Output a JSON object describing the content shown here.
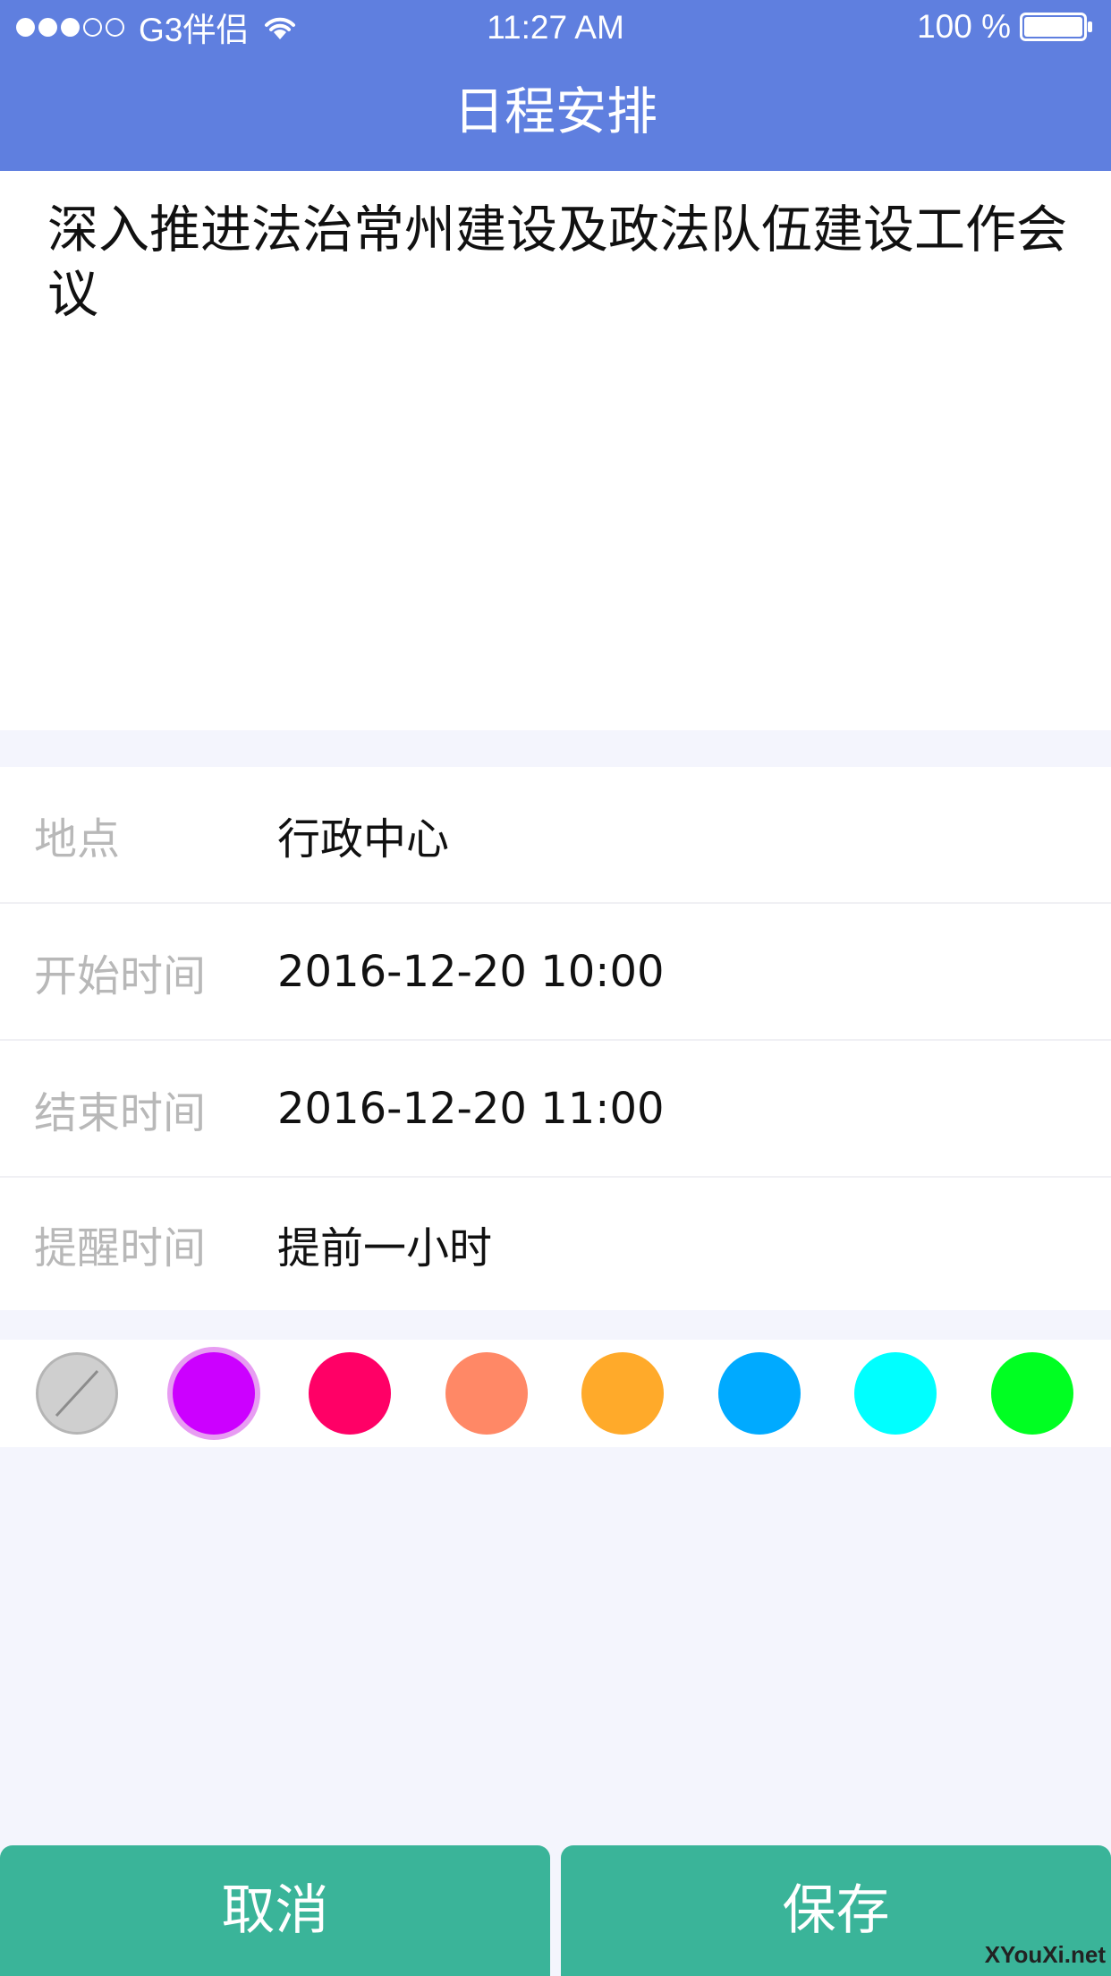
{
  "status_bar": {
    "carrier": "G3伴侣",
    "time": "11:27 AM",
    "battery": "100 %",
    "signal_dots_filled": 3,
    "signal_dots_total": 5
  },
  "nav": {
    "title": "日程安排"
  },
  "event": {
    "title": "深入推进法治常州建设及政法队伍建设工作会议"
  },
  "details": [
    {
      "label": "地点",
      "value": "行政中心"
    },
    {
      "label": "开始时间",
      "value": "2016-12-20 10:00"
    },
    {
      "label": "结束时间",
      "value": "2016-12-20 11:00"
    },
    {
      "label": "提醒时间",
      "value": "提前一小时"
    }
  ],
  "colors": {
    "options": [
      "none",
      "#cc00ff",
      "#ff0066",
      "#ff8866",
      "#ffaa2a",
      "#00aaff",
      "#00ffff",
      "#00ff22"
    ],
    "selected_index": 1,
    "accent_header": "#5f7fdf",
    "accent_button": "#3ab499"
  },
  "actions": {
    "cancel_label": "取消",
    "save_label": "保存"
  },
  "watermark": {
    "text": "XYouXi.net"
  }
}
